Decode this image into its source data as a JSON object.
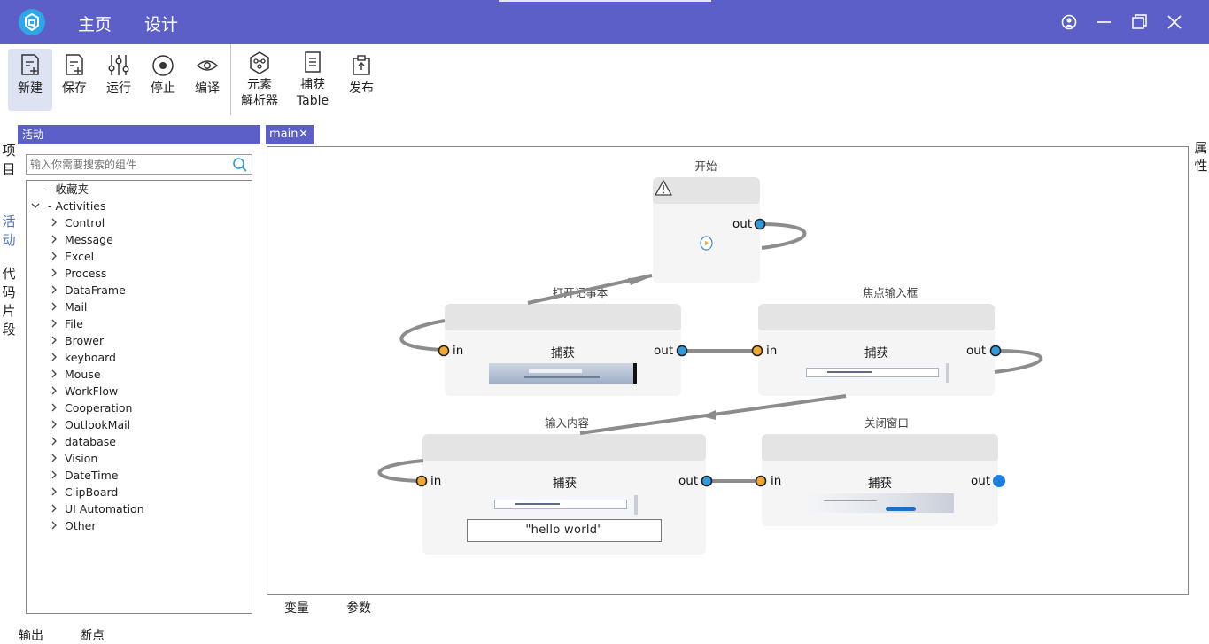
{
  "titlebar": {
    "menu": [
      "主页",
      "设计"
    ],
    "accent_color": "#5b5fc7"
  },
  "toolbar": {
    "buttons": [
      {
        "label": "新建",
        "icon": "new-file-icon",
        "active": true
      },
      {
        "label": "保存",
        "icon": "save-file-icon"
      },
      {
        "label": "运行",
        "icon": "sliders-icon"
      },
      {
        "label": "停止",
        "icon": "stop-circle-icon"
      },
      {
        "label": "编译",
        "icon": "eye-icon"
      },
      {
        "label_line1": "元素",
        "label_line2": "解析器",
        "icon": "element-parser-icon"
      },
      {
        "label_line1": "捕获",
        "label_line2": "Table",
        "icon": "capture-table-icon"
      },
      {
        "label": "发布",
        "icon": "publish-icon"
      }
    ]
  },
  "left_vtabs": [
    "项目",
    "活动",
    "代码片段"
  ],
  "activities_panel": {
    "header": "活动",
    "search_placeholder": "输入你需要搜索的组件",
    "favorites": "- 收藏夹",
    "root": "- Activities",
    "items": [
      "Control",
      "Message",
      "Excel",
      "Process",
      "DataFrame",
      "Mail",
      "File",
      "Brower",
      "keyboard",
      "Mouse",
      "WorkFlow",
      "Cooperation",
      "OutlookMail",
      "database",
      "Vision",
      "DateTime",
      "ClipBoard",
      "UI Automation",
      "Other"
    ]
  },
  "canvas": {
    "tab_label": "main",
    "tab_close": "✕",
    "nodes": {
      "start": {
        "title": "开始",
        "out": "out"
      },
      "open_notepad": {
        "title": "打开记事本",
        "in": "in",
        "capture": "捕获",
        "out": "out"
      },
      "focus_input": {
        "title": "焦点输入框",
        "in": "in",
        "capture": "捕获",
        "out": "out"
      },
      "input_content": {
        "title": "输入内容",
        "in": "in",
        "capture": "捕获",
        "out": "out",
        "text_value": "\"hello world\""
      },
      "close_window": {
        "title": "关闭窗口",
        "in": "in",
        "capture": "捕获",
        "out": "out"
      }
    },
    "port_color_in": "#f0a830",
    "port_color_out": "#3399dd"
  },
  "bottom_tabs": [
    "变量",
    "参数"
  ],
  "right_vtab": "属性",
  "output_tabs": [
    "输出",
    "断点"
  ]
}
